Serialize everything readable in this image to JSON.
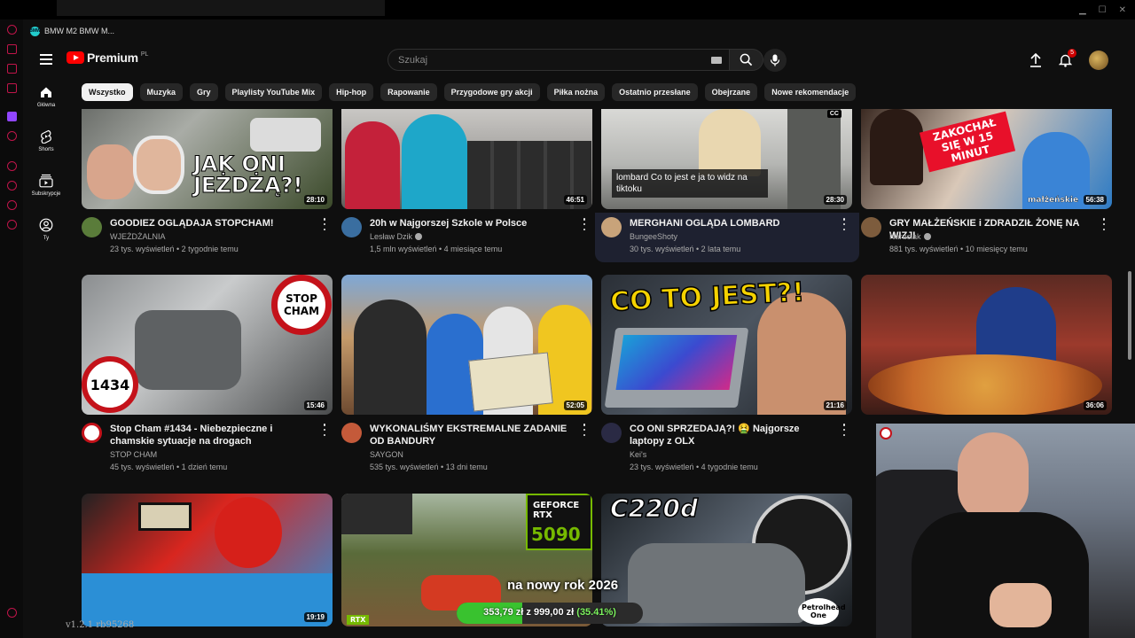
{
  "window": {
    "title": "BMW M2 BMW M..."
  },
  "header": {
    "logo_text": "Premium",
    "logo_country": "PL",
    "search_placeholder": "Szukaj",
    "notification_count": "5"
  },
  "guide": [
    {
      "label": "Główna",
      "icon": "home-icon"
    },
    {
      "label": "Shorts",
      "icon": "shorts-icon"
    },
    {
      "label": "Subskrypcje",
      "icon": "subscriptions-icon"
    },
    {
      "label": "Ty",
      "icon": "you-icon"
    }
  ],
  "chips": [
    "Wszystko",
    "Muzyka",
    "Gry",
    "Playlisty YouTube Mix",
    "Hip-hop",
    "Rapowanie",
    "Przygodowe gry akcji",
    "Piłka nożna",
    "Ostatnio przesłane",
    "Obejrzane",
    "Nowe rekomendacje"
  ],
  "videos": [
    {
      "title": "GOODIEZ OGLĄDAJA STOPCHAM!",
      "channel": "WJEŻDŻALNIA",
      "stats": "23 tys. wyświetleń • 2 tygodnie temu",
      "duration": "28:10",
      "overlay": "JAK ONI JEŻDŻĄ?!",
      "accent": "#f5e017"
    },
    {
      "title": "20h w Najgorszej Szkole w Polsce",
      "channel": "Lesław Dzik",
      "stats": "1,5 mln wyświetleń • 4 miesiące temu",
      "duration": "46:51"
    },
    {
      "title": "MERGHANI OGLĄDA LOMBARD",
      "channel": "BungeeShoty",
      "stats": "30 tys. wyświetleń • 2 lata temu",
      "duration": "28:30",
      "overlay": "lombard Co to jest e ja to widz na tiktoku",
      "badge": "CC"
    },
    {
      "title": "GRY MAŁŻEŃSKIE i ZDRADZIŁ ŻONĘ NA WIZJI",
      "channel": "Naruciak",
      "stats": "881 tys. wyświetleń • 10 miesięcy temu",
      "duration": "56:38",
      "overlay": "ZAKOCHAŁ SIĘ W 15 MINUT",
      "overlay2": "małżeńskie",
      "accent": "#e8102a"
    },
    {
      "title": "Stop Cham #1434 - Niebezpieczne i chamskie sytuacje na drogach",
      "channel": "STOP CHAM",
      "stats": "45 tys. wyświetleń • 1 dzień temu",
      "duration": "15:46",
      "overlay": "STOP CHAM",
      "overlay2": "1434"
    },
    {
      "title": "WYKONALIŚMY EKSTREMALNE ZADANIE OD BANDURY",
      "channel": "SAYGON",
      "stats": "535 tys. wyświetleń • 13 dni temu",
      "duration": "52:05"
    },
    {
      "title": "CO ONI SPRZEDAJĄ?! 🤮 Najgorsze laptopy z OLX",
      "channel": "Kei's",
      "stats": "23 tys. wyświetleń • 4 tygodnie temu",
      "duration": "21:16",
      "overlay": "CO TO JEST?!",
      "accent": "#f5d200"
    },
    {
      "title": "",
      "channel": "",
      "stats": "",
      "duration": "36:06"
    },
    {
      "title": "",
      "channel": "",
      "stats": "",
      "duration": "19:19"
    },
    {
      "title": "",
      "channel": "",
      "stats": "",
      "duration": "",
      "overlay": "GEFORCE RTX",
      "overlay2": "5090",
      "overlay3": "RTX"
    },
    {
      "title": "",
      "channel": "",
      "stats": "",
      "duration": "",
      "overlay": "C220d",
      "overlay2": "Petrolhead One"
    }
  ],
  "stream_overlay": {
    "goal_caption": "na nowy rok 2026",
    "goal_text": "353,79 zł z 999,00 zł",
    "goal_percent": "(35.41%)",
    "goal_fraction": 0.3541,
    "version": "v1.2.1 rb95268"
  },
  "colors": {
    "accent": "#ff0000",
    "background": "#0f0f0f",
    "chip_active": "#f1f1f1",
    "goal_fill": "#39c22f"
  }
}
